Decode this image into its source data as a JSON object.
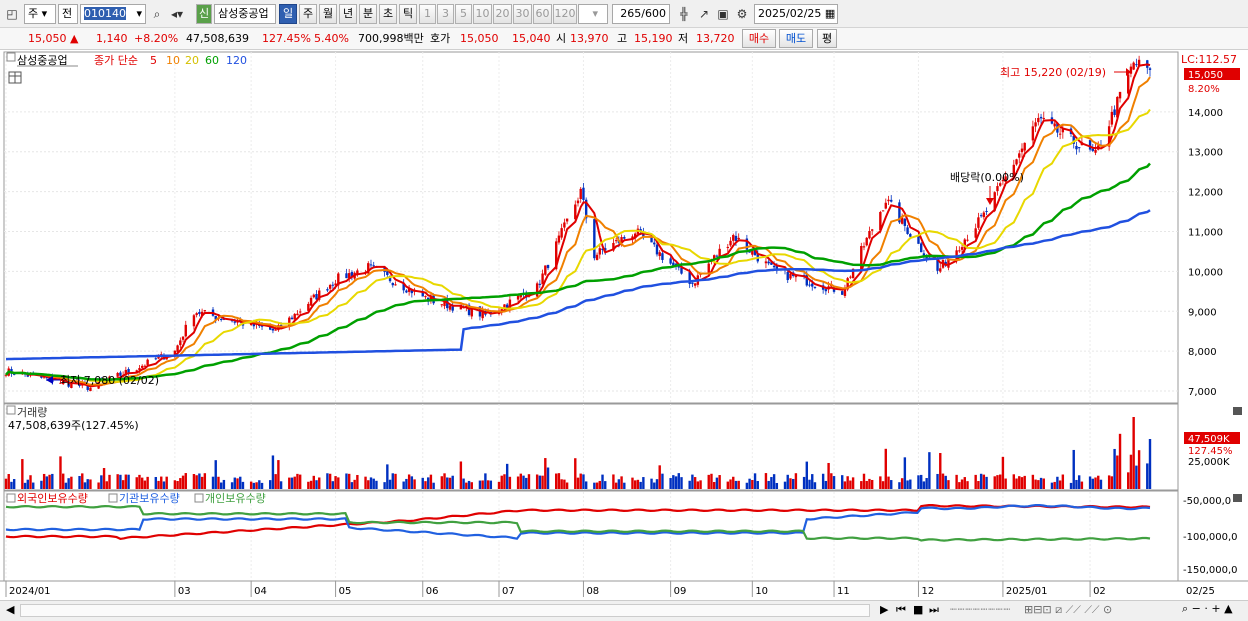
{
  "toolbar": {
    "market_type": "주",
    "period_select": "전",
    "code": "010140",
    "new_badge": "신",
    "stock_name": "삼성중공업",
    "periods": [
      "일",
      "주",
      "월",
      "년",
      "분",
      "초",
      "틱"
    ],
    "active_period": "일",
    "intervals": [
      "1",
      "3",
      "5",
      "10",
      "20",
      "30",
      "60",
      "120"
    ],
    "count": "265",
    "count_total": "/600",
    "date": "2025/02/25"
  },
  "quote": {
    "price": "15,050",
    "change": "1,140",
    "change_pct": "+8.20%",
    "volume": "47,508,639",
    "volume_ratio": "127.45%",
    "turnover": "5.40%",
    "amount": "700,998백만",
    "ask_label": "호가",
    "ask": "15,050",
    "bid": "15,040",
    "open_label": "시",
    "open": "13,970",
    "high_label": "고",
    "high": "15,190",
    "low_label": "저",
    "low": "13,720",
    "buy_label": "매수",
    "sell_label": "매도",
    "avg_label": "평"
  },
  "price_panel": {
    "stock": "삼성중공업",
    "ma_title": "종가 단순",
    "ma_periods": [
      "5",
      "10",
      "20",
      "60",
      "120"
    ],
    "lc_label": "LC:112.57",
    "max_note": "최고 15,220 (02/19)",
    "min_note": "최저 7,080 (02/02)",
    "dividend_note": "배당락(0.00%)",
    "last_price_tag": "15,050",
    "last_pct_tag": "8.20%",
    "y_ticks": [
      "14,000",
      "13,000",
      "12,000",
      "11,000",
      "10,000",
      "9,000",
      "8,000",
      "7,000"
    ]
  },
  "volume_panel": {
    "title": "거래량",
    "value": "47,508,639주(127.45%)",
    "tag": "47,509K",
    "tag_pct": "127.45%",
    "tick": "25,000K"
  },
  "holdings_panel": {
    "series": [
      "외국인보유수량",
      "기관보유수량",
      "개인보유수량"
    ],
    "y_ticks": [
      "-50,000,0",
      "-100,000,0",
      "-150,000,0"
    ]
  },
  "x_axis": [
    "2024/01",
    "03",
    "04",
    "05",
    "06",
    "07",
    "08",
    "09",
    "10",
    "11",
    "12",
    "2025/01",
    "02",
    "02/25"
  ],
  "colors": {
    "ma5": "#e00000",
    "ma10": "#f08000",
    "ma20": "#e8d800",
    "ma60": "#00a000",
    "ma120": "#2050e0",
    "up": "#e00000",
    "down": "#0030c0",
    "foreign": "#e00000",
    "inst": "#2060e0",
    "indiv": "#40a040"
  },
  "chart_data": {
    "type": "candlestick",
    "price_range": [
      6700,
      15500
    ],
    "price_anchors": [
      [
        "2024/01/02",
        7500
      ],
      [
        "2024/02/02",
        7080
      ],
      [
        "2024/03/04",
        8000
      ],
      [
        "2024/03/11",
        9000
      ],
      [
        "2024/04/10",
        8500
      ],
      [
        "2024/05/02",
        9800
      ],
      [
        "2024/05/14",
        10100
      ],
      [
        "2024/06/05",
        9300
      ],
      [
        "2024/06/26",
        8900
      ],
      [
        "2024/07/15",
        9600
      ],
      [
        "2024/07/31",
        12000
      ],
      [
        "2024/08/05",
        10400
      ],
      [
        "2024/08/20",
        11000
      ],
      [
        "2024/09/10",
        9700
      ],
      [
        "2024/09/25",
        10900
      ],
      [
        "2024/10/10",
        10000
      ],
      [
        "2024/11/04",
        9500
      ],
      [
        "2024/11/20",
        11800
      ],
      [
        "2024/12/09",
        10000
      ],
      [
        "2024/12/26",
        11400
      ],
      [
        "2025/01/15",
        13800
      ],
      [
        "2025/02/05",
        12900
      ],
      [
        "2025/02/19",
        15220
      ],
      [
        "2025/02/25",
        15050
      ]
    ]
  }
}
